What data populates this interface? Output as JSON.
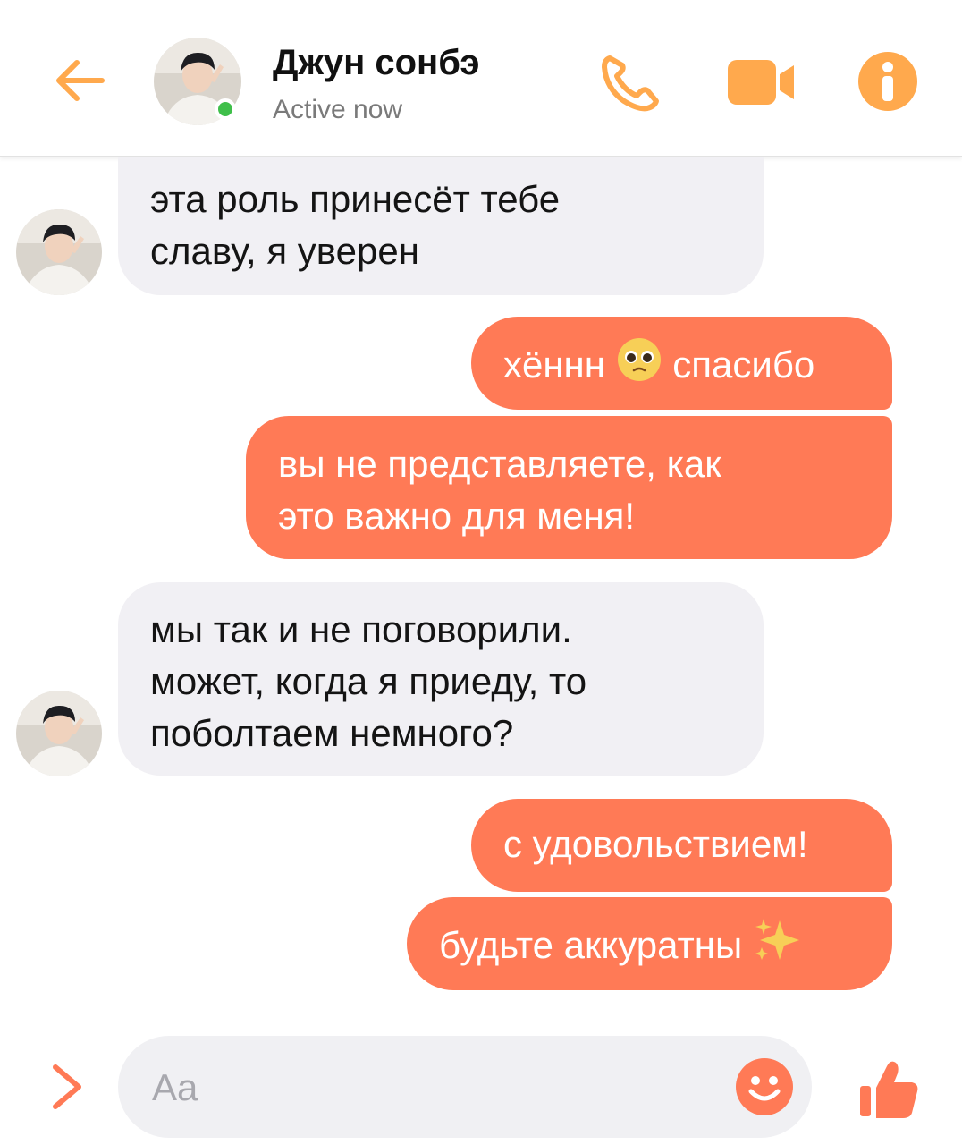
{
  "colors": {
    "accent": "#ffa94d",
    "outgoing_bubble": "#ff7a56",
    "incoming_bubble": "#f1f0f4",
    "online": "#3fbf4a"
  },
  "header": {
    "contact_name": "Джун сонбэ",
    "status": "Active now",
    "icons": [
      "back-arrow-icon",
      "phone-icon",
      "video-camera-icon",
      "info-icon"
    ]
  },
  "messages": [
    {
      "side": "incoming",
      "lines": [
        "эта роль принесёт тебе",
        "славу, я уверен"
      ]
    },
    {
      "side": "outgoing",
      "before_emoji": "хённн",
      "emoji": "pleading-face-emoji",
      "after_emoji": "спасибо"
    },
    {
      "side": "outgoing",
      "lines": [
        "вы не представляете, как",
        "это важно для меня!"
      ]
    },
    {
      "side": "incoming",
      "lines": [
        "мы так и не поговорили.",
        "может, когда я приеду, то",
        "поболтаем немного?"
      ]
    },
    {
      "side": "outgoing",
      "lines": [
        "с удовольствием!"
      ]
    },
    {
      "side": "outgoing",
      "before_emoji": "будьте аккуратны",
      "emoji": "sparkles-emoji"
    }
  ],
  "composer": {
    "placeholder": "Aa",
    "icons": [
      "chevron-right-icon",
      "smiley-icon",
      "thumbs-up-icon"
    ]
  }
}
